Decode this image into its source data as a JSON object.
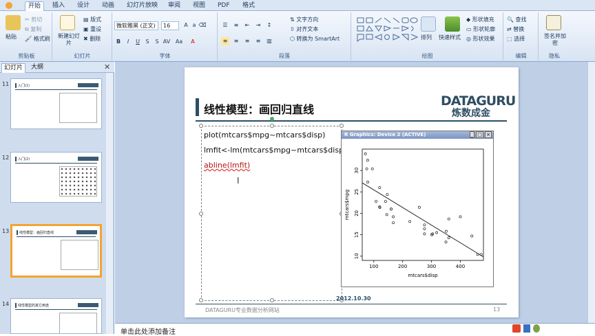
{
  "ribbon": {
    "tabs": [
      "开始",
      "插入",
      "设计",
      "动画",
      "幻灯片放映",
      "审阅",
      "视图",
      "PDF",
      "格式"
    ],
    "active_tab": "开始",
    "groups": {
      "clipboard": {
        "label": "剪贴板",
        "paste": "粘贴",
        "cut": "剪切",
        "copy": "复制",
        "format_painter": "格式刷"
      },
      "slides": {
        "label": "幻灯片",
        "new_slide": "新建幻灯片",
        "layout": "版式",
        "reset": "重设",
        "delete": "删除"
      },
      "font": {
        "label": "字体",
        "font_name": "微软雅黑 (正文)",
        "font_size": "16"
      },
      "paragraph": {
        "label": "段落",
        "text_direction": "文字方向",
        "align_text": "对齐文本",
        "smartart": "转换为 SmartArt"
      },
      "drawing": {
        "label": "绘图",
        "arrange": "排列",
        "quick_styles": "快速样式",
        "shape_fill": "形状填充",
        "shape_outline": "形状轮廓",
        "shape_effects": "形状效果"
      },
      "editing": {
        "label": "编辑",
        "find": "查找",
        "replace": "替换",
        "select": "选择"
      },
      "privacy": {
        "label": "隐私",
        "sign_encrypt": "签名并加密"
      }
    }
  },
  "leftpane": {
    "tabs": [
      "幻灯片",
      "大纲"
    ],
    "active_tab": "幻灯片",
    "slides": [
      {
        "num": "11",
        "title": "入门(1)"
      },
      {
        "num": "12",
        "title": "入门(2)"
      },
      {
        "num": "13",
        "title": "线性模型：画回归直线",
        "selected": true
      },
      {
        "num": "14",
        "title": "线性模型的其它用途"
      }
    ]
  },
  "slide": {
    "title": "线性模型：画回归直线",
    "logo_top": "DATAGURU",
    "logo_bottom": "炼数成金",
    "code_lines": [
      "plot(mtcars$mpg~mtcars$disp)",
      "lmfit<-lm(mtcars$mpg~mtcars$disp)",
      "abline(lmfit)"
    ],
    "date": "2012.10.30",
    "footer": "DATAGURU专业数据分析网站",
    "page_number": "13"
  },
  "r_window": {
    "title": "R Graphics: Device 2 (ACTIVE)"
  },
  "chart_data": {
    "type": "scatter",
    "xlabel": "mtcars$disp",
    "ylabel": "mtcars$mpg",
    "xlim": [
      60,
      480
    ],
    "ylim": [
      9,
      35
    ],
    "xticks": [
      100,
      200,
      300,
      400
    ],
    "yticks": [
      10,
      15,
      20,
      25,
      30
    ],
    "points": [
      [
        160,
        21.0
      ],
      [
        160,
        21.0
      ],
      [
        108,
        22.8
      ],
      [
        258,
        21.4
      ],
      [
        360,
        18.7
      ],
      [
        225,
        18.1
      ],
      [
        360,
        14.3
      ],
      [
        146.7,
        24.4
      ],
      [
        140.8,
        22.8
      ],
      [
        167.6,
        19.2
      ],
      [
        167.6,
        17.8
      ],
      [
        275.8,
        16.4
      ],
      [
        275.8,
        17.3
      ],
      [
        275.8,
        15.2
      ],
      [
        472,
        10.4
      ],
      [
        460,
        10.4
      ],
      [
        440,
        14.7
      ],
      [
        78.7,
        32.4
      ],
      [
        75.7,
        30.4
      ],
      [
        71.1,
        33.9
      ],
      [
        120.1,
        21.5
      ],
      [
        318,
        15.5
      ],
      [
        304,
        15.2
      ],
      [
        350,
        13.3
      ],
      [
        400,
        19.2
      ],
      [
        79,
        27.3
      ],
      [
        120.3,
        26.0
      ],
      [
        95.1,
        30.4
      ],
      [
        351,
        15.8
      ],
      [
        145,
        19.7
      ],
      [
        301,
        15.0
      ],
      [
        121,
        21.4
      ]
    ],
    "regression_line": {
      "intercept": 29.6,
      "slope": -0.0412
    }
  },
  "notes": {
    "placeholder": "单击此处添加备注"
  }
}
